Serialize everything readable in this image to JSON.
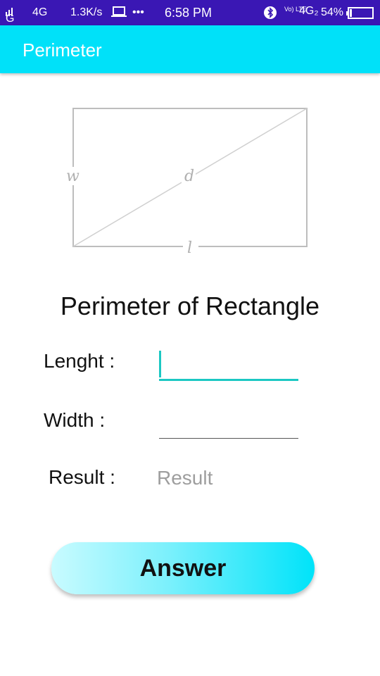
{
  "status_bar": {
    "signal_1": "G",
    "network_1": "4G",
    "speed": "1.3K/s",
    "more": "•••",
    "time": "6:58 PM",
    "volte": "Vo) LTE",
    "network_2": "4G₂",
    "battery": "54%"
  },
  "app_bar": {
    "title": "Perimeter"
  },
  "diagram": {
    "label_w": "w",
    "label_d": "d",
    "label_l": "l"
  },
  "heading": "Perimeter of Rectangle",
  "form": {
    "length_label": "Lenght :",
    "length_value": "",
    "width_label": "Width :",
    "width_value": "",
    "result_label": "Result :",
    "result_value": "Result"
  },
  "answer_button": "Answer"
}
